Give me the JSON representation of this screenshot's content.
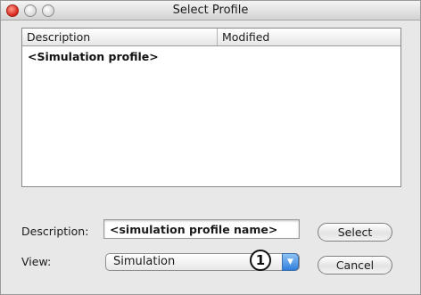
{
  "window": {
    "title": "Select Profile"
  },
  "table": {
    "columns": [
      "Description",
      "Modified"
    ],
    "rows": [
      {
        "description": "<Simulation profile>",
        "modified": ""
      }
    ]
  },
  "form": {
    "description_label": "Description:",
    "description_value": "<simulation profile name>",
    "view_label": "View:",
    "view_value": "Simulation",
    "callout_number": "1"
  },
  "buttons": {
    "select_label": "Select",
    "cancel_label": "Cancel"
  },
  "colors": {
    "window_bg": "#e8e8e8",
    "close_button": "#d6211a",
    "select_arrow": "#2f7fdc"
  },
  "icons": {
    "close": "close-icon",
    "minimize": "minimize-icon",
    "zoom": "zoom-icon",
    "dropdown": "chevron-down-icon"
  }
}
